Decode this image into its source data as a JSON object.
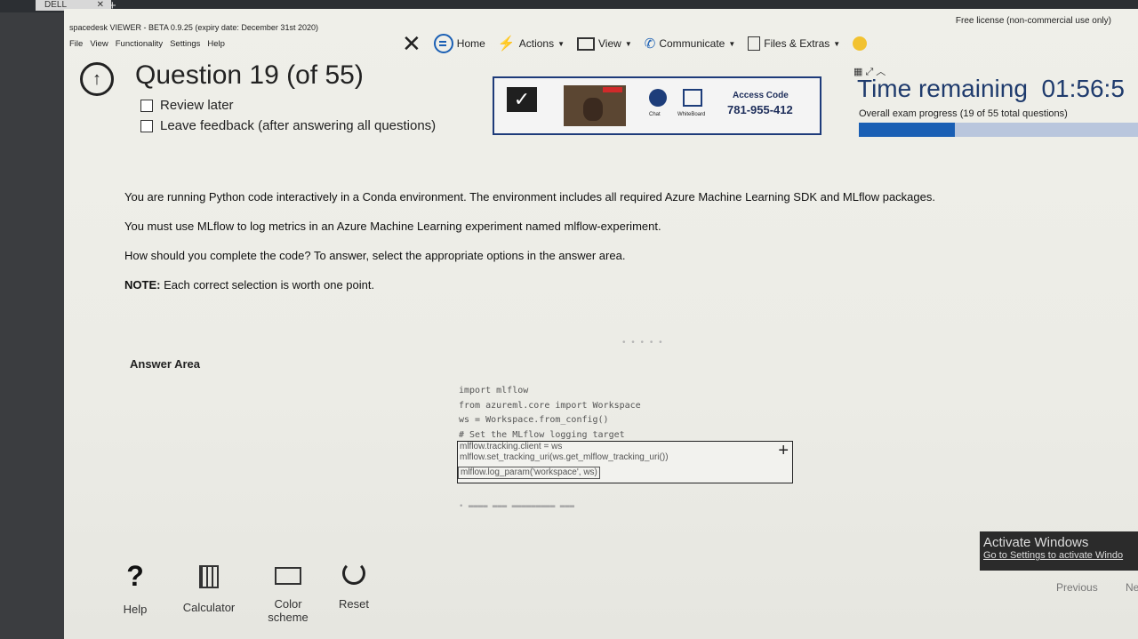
{
  "browser": {
    "tab_label": "DELL",
    "tab_close": "✕",
    "new_tab": "+"
  },
  "spacedesk": {
    "title": "spacedesk VIEWER - BETA 0.9.25 (expiry date: December 31st 2020)",
    "menu": [
      "File",
      "View",
      "Functionality",
      "Settings",
      "Help"
    ],
    "license": "Free license (non-commercial use only)",
    "toolbar": {
      "home": "Home",
      "actions": "Actions",
      "view": "View",
      "communicate": "Communicate",
      "files": "Files & Extras"
    },
    "panel": {
      "chat": "Chat",
      "whiteboard": "WhiteBoard",
      "access_label": "Access Code",
      "access_code": "781-955-412"
    }
  },
  "exam": {
    "title": "Question 19 (of 55)",
    "review_later": "Review later",
    "leave_feedback": "Leave feedback (after answering all questions)",
    "timer_label": "Time remaining",
    "timer_value": "01:56:5",
    "progress_text": "Overall exam progress (19 of 55 total questions)",
    "progress_fraction": 0.345
  },
  "question": {
    "p1": "You are running Python code interactively in a Conda environment. The environment includes all required Azure Machine Learning SDK and MLflow packages.",
    "p2": "You must use MLflow to log metrics in an Azure Machine Learning experiment named mlflow-experiment.",
    "p3": "How should you complete the code? To answer, select the appropriate options in the answer area.",
    "note_label": "NOTE:",
    "note_text": "Each correct selection is worth one point.",
    "answer_area": "Answer Area",
    "code_lines": [
      "import mlflow",
      "from azureml.core import Workspace",
      "ws = Workspace.from_config()",
      "# Set the MLflow logging target"
    ],
    "dropdown_options": [
      "mlflow.tracking.client = ws",
      "mlflow.set_tracking_uri(ws.get_mlflow_tracking_uri())",
      "mlflow.log_param('workspace', ws)"
    ]
  },
  "tools": {
    "help": "Help",
    "calculator": "Calculator",
    "color_scheme_1": "Color",
    "color_scheme_2": "scheme",
    "reset": "Reset"
  },
  "nav": {
    "previous": "Previous",
    "next": "Ne"
  },
  "windows": {
    "activate_title": "Activate Windows",
    "activate_sub": "Go to Settings to activate Windo"
  }
}
